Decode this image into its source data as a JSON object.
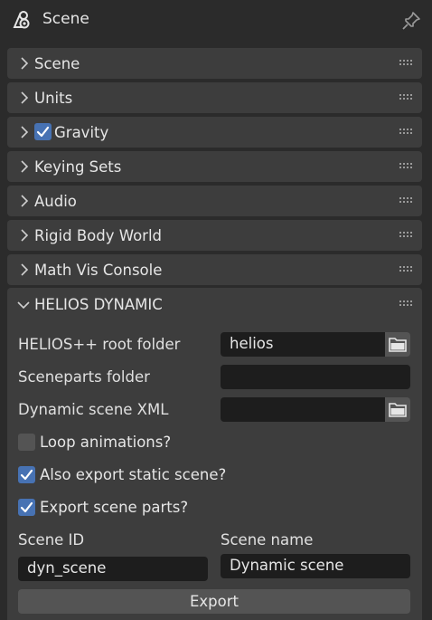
{
  "header": {
    "title": "Scene",
    "icon": "scene-icon",
    "pin_icon": "pin-icon"
  },
  "panels": [
    {
      "label": "Scene"
    },
    {
      "label": "Units"
    },
    {
      "label": "Gravity",
      "checked": true
    },
    {
      "label": "Keying Sets"
    },
    {
      "label": "Audio"
    },
    {
      "label": "Rigid Body World"
    },
    {
      "label": "Math Vis Console"
    }
  ],
  "helios": {
    "title": "HELIOS DYNAMIC",
    "root_folder_label": "HELIOS++ root folder",
    "root_folder_value": "helios",
    "sceneparts_label": "Sceneparts folder",
    "sceneparts_value": "",
    "dynamic_xml_label": "Dynamic scene XML",
    "dynamic_xml_value": "",
    "loop_label": "Loop animations?",
    "loop_checked": false,
    "static_label": "Also export static scene?",
    "static_checked": true,
    "parts_label": "Export scene parts?",
    "parts_checked": true,
    "scene_id_label": "Scene ID",
    "scene_id_value": "dyn_scene",
    "scene_name_label": "Scene name",
    "scene_name_value": "Dynamic scene",
    "export_label": "Export"
  },
  "colors": {
    "background": "#2b2b2b",
    "panel": "#3d3d3d",
    "field": "#1d1d1d",
    "button": "#545454",
    "accent": "#4772b3",
    "text": "#e6e6e6"
  }
}
